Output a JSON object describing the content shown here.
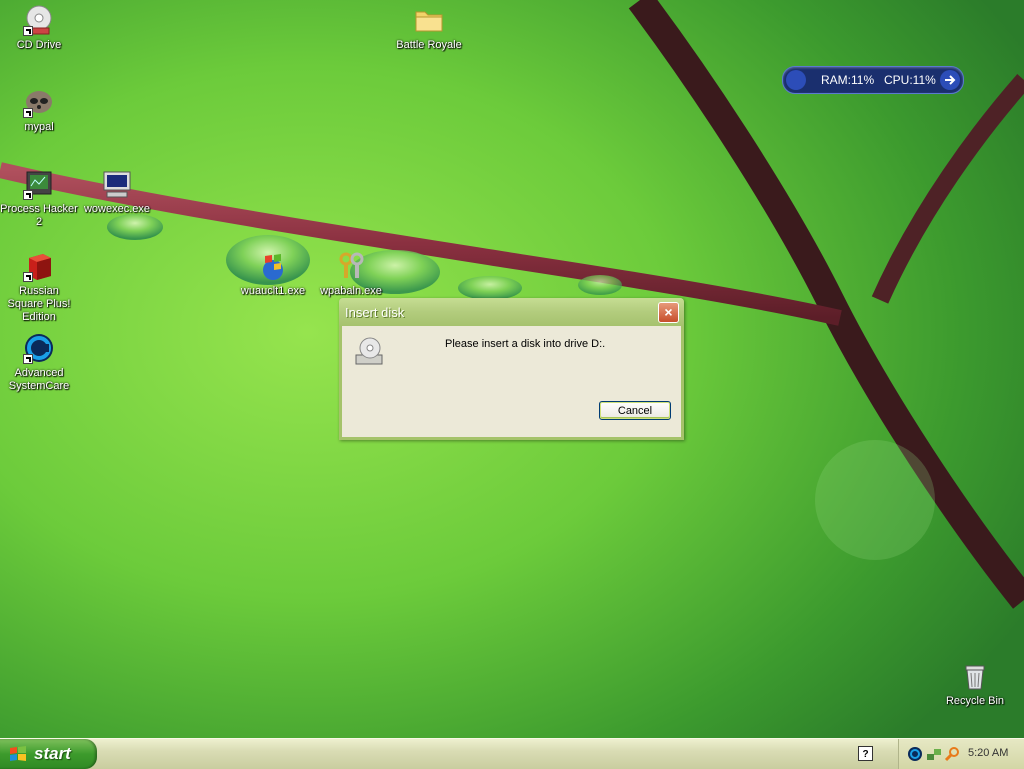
{
  "desktop": {
    "icons": [
      {
        "label": "CD Drive",
        "icon": "cd-drive-icon"
      },
      {
        "label": "Battle Royale",
        "icon": "folder-icon"
      },
      {
        "label": "mypal",
        "icon": "raccoon-icon"
      },
      {
        "label": "Process Hacker 2",
        "icon": "process-hacker-icon"
      },
      {
        "label": "wowexec.exe",
        "icon": "computer-icon"
      },
      {
        "label": "wuauclt1.exe",
        "icon": "windows-update-icon"
      },
      {
        "label": "wpabaln.exe",
        "icon": "keys-icon"
      },
      {
        "label": "Russian Square Plus! Edition",
        "icon": "red-cube-icon"
      },
      {
        "label": "Advanced SystemCare",
        "icon": "advanced-systemcare-icon"
      },
      {
        "label": "Recycle Bin",
        "icon": "recycle-bin-icon"
      }
    ]
  },
  "sysmon": {
    "ram": "RAM:11%",
    "cpu": "CPU:11%"
  },
  "dialog": {
    "title": "Insert disk",
    "message": "Please insert a disk into drive D:.",
    "cancel_label": "Cancel",
    "close_label": "×"
  },
  "taskbar": {
    "start_label": "start",
    "help_label": "?",
    "clock": "5:20 AM"
  },
  "colors": {
    "taskbar": "#d9dcb4",
    "start_button": "#3d9b2c",
    "dialog_titlebar": "#b2cc7d",
    "dialog_body": "#ece9d8",
    "close_button": "#c74e2c"
  }
}
